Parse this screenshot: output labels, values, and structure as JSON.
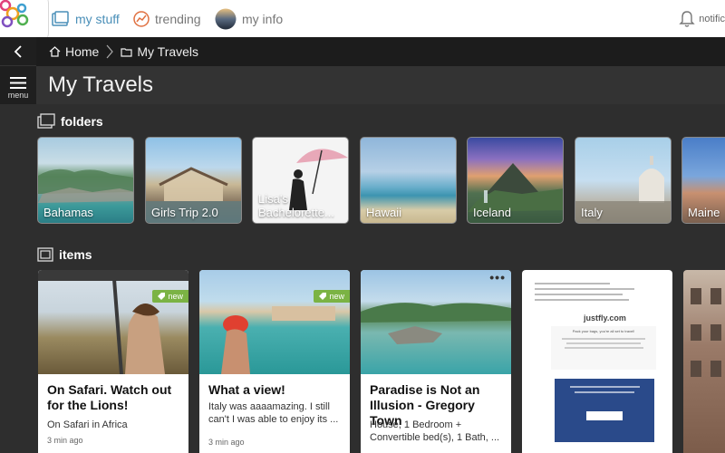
{
  "nav": {
    "tabs": [
      {
        "label": "my stuff",
        "icon": "folder-icon"
      },
      {
        "label": "trending",
        "icon": "trending-icon"
      },
      {
        "label": "my info",
        "icon": "profile-avatar"
      }
    ],
    "notifications_label": "notific"
  },
  "rail": {
    "menu_label": "menu"
  },
  "breadcrumb": {
    "home": "Home",
    "current": "My Travels"
  },
  "page": {
    "title": "My Travels"
  },
  "folders": {
    "heading": "folders",
    "items": [
      {
        "label": "Bahamas"
      },
      {
        "label": "Girls Trip 2.0"
      },
      {
        "label": "Lisa's Bachelorette..."
      },
      {
        "label": "Hawaii"
      },
      {
        "label": "Iceland"
      },
      {
        "label": "Italy"
      },
      {
        "label": "Maine"
      }
    ]
  },
  "items": {
    "heading": "items",
    "cards": [
      {
        "title": "On Safari. Watch out for the Lions!",
        "subtitle": "On Safari in Africa",
        "time": "3 min ago",
        "badge": "new"
      },
      {
        "title": "What a view!",
        "subtitle": "Italy was aaaamazing.  I still can't I was able to enjoy its ...",
        "time": "3 min ago",
        "badge": "new"
      },
      {
        "title": "Paradise is Not an Illusion - Gregory Town",
        "subtitle": "House, 1 Bedroom + Convertible bed(s), 1 Bath, ...",
        "menu": "•••"
      },
      {
        "brand": "justfly.com",
        "heading": "Pack your bags, you're all set to travel!"
      }
    ]
  },
  "colors": {
    "accent": "#4a8fb8",
    "badge": "#7bb344",
    "trending": "#e07040"
  }
}
